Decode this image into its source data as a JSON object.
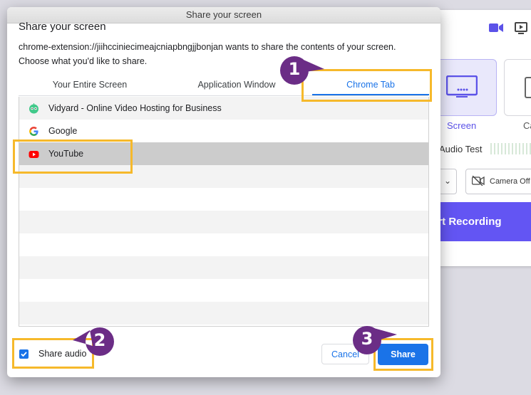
{
  "background_app": {
    "screen_label": "Screen",
    "camera_label_fragment": "Ca",
    "audio_test_label": "Audio Test",
    "camera_off_label": "Camera Off",
    "record_button_label": "art Recording",
    "accent_color": "#6355f3"
  },
  "dialog": {
    "window_title": "Share your screen",
    "heading": "Share your screen",
    "description_line1": "chrome-extension://jiihcciniecimeajcniapbngjjbonjan wants to share the contents of your screen.",
    "description_line2": "Choose what you'd like to share.",
    "tabs": [
      {
        "label": "Your Entire Screen",
        "selected": false
      },
      {
        "label": "Application Window",
        "selected": false
      },
      {
        "label": "Chrome Tab",
        "selected": true
      }
    ],
    "chrome_tabs": [
      {
        "label": "Vidyard - Online Video Hosting for Business",
        "icon": "vidyard-icon",
        "selected": false
      },
      {
        "label": "Google",
        "icon": "google-icon",
        "selected": false
      },
      {
        "label": "YouTube",
        "icon": "youtube-icon",
        "selected": true
      }
    ],
    "share_audio": {
      "label": "Share audio",
      "checked": true
    },
    "cancel_label": "Cancel",
    "share_label": "Share",
    "accent_color": "#1a73e8"
  },
  "annotations": {
    "step1": "1",
    "step2": "2",
    "step3": "3",
    "highlight_color": "#f6b92b",
    "bubble_color": "#6b2d86"
  }
}
